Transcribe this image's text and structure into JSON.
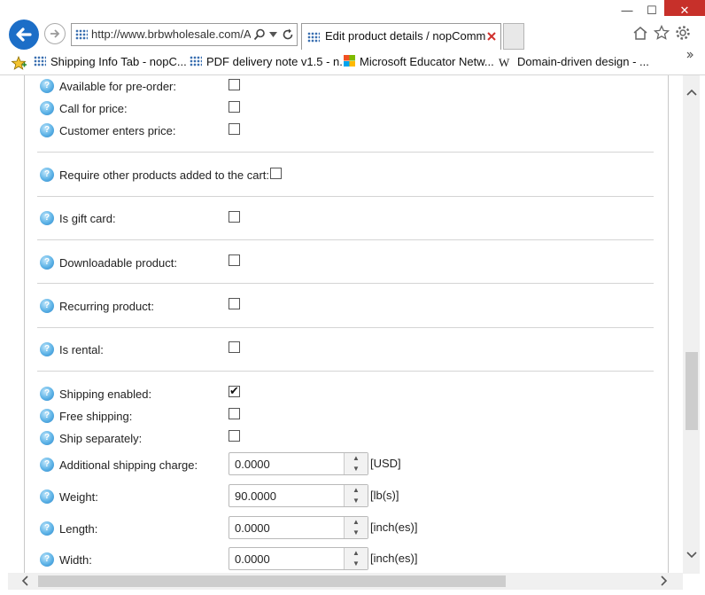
{
  "window": {
    "minimize": "—",
    "maximize": "☐",
    "close": "✕"
  },
  "nav": {
    "address": "http://www.brbwholesale.com/A",
    "tab_title": "Edit product details / nopComm"
  },
  "favorites": [
    {
      "label": "Shipping Info Tab - nopC..."
    },
    {
      "label": "PDF delivery note  v1.5 - n..."
    },
    {
      "label": "Microsoft Educator Netw..."
    },
    {
      "label": "Domain-driven design - ..."
    }
  ],
  "form": {
    "available_preorder": {
      "label": "Available for pre-order:",
      "checked": false
    },
    "call_for_price": {
      "label": "Call for price:",
      "checked": false
    },
    "customer_enters_price": {
      "label": "Customer enters price:",
      "checked": false
    },
    "require_other_products": {
      "label": "Require other products added to the cart:",
      "checked": false
    },
    "is_gift_card": {
      "label": "Is gift card:",
      "checked": false
    },
    "downloadable": {
      "label": "Downloadable product:",
      "checked": false
    },
    "recurring": {
      "label": "Recurring product:",
      "checked": false
    },
    "is_rental": {
      "label": "Is rental:",
      "checked": false
    },
    "shipping_enabled": {
      "label": "Shipping enabled:",
      "checked": true
    },
    "free_shipping": {
      "label": "Free shipping:",
      "checked": false
    },
    "ship_separately": {
      "label": "Ship separately:",
      "checked": false
    },
    "additional_shipping_charge": {
      "label": "Additional shipping charge:",
      "value": "0.0000",
      "unit": "[USD]"
    },
    "weight": {
      "label": "Weight:",
      "value": "90.0000",
      "unit": "[lb(s)]"
    },
    "length": {
      "label": "Length:",
      "value": "0.0000",
      "unit": "[inch(es)]"
    },
    "width": {
      "label": "Width:",
      "value": "0.0000",
      "unit": "[inch(es)]"
    }
  },
  "help_glyph": "?",
  "check_glyph": "✔"
}
